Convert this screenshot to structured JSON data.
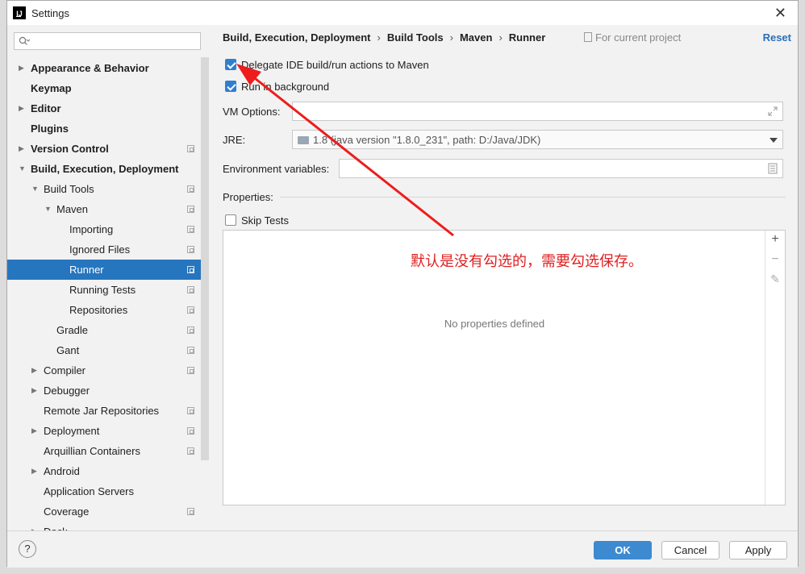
{
  "window": {
    "title": "Settings",
    "close_label": "✕"
  },
  "sidebar": {
    "search_placeholder": "",
    "items": [
      {
        "label": "Appearance & Behavior",
        "level": 0,
        "arrow": "right",
        "bold": true,
        "proj": false
      },
      {
        "label": "Keymap",
        "level": 0,
        "arrow": "",
        "bold": true,
        "proj": false
      },
      {
        "label": "Editor",
        "level": 0,
        "arrow": "right",
        "bold": true,
        "proj": false
      },
      {
        "label": "Plugins",
        "level": 0,
        "arrow": "",
        "bold": true,
        "proj": false
      },
      {
        "label": "Version Control",
        "level": 0,
        "arrow": "right",
        "bold": true,
        "proj": true
      },
      {
        "label": "Build, Execution, Deployment",
        "level": 0,
        "arrow": "down",
        "bold": true,
        "proj": false
      },
      {
        "label": "Build Tools",
        "level": 1,
        "arrow": "down",
        "bold": false,
        "proj": true
      },
      {
        "label": "Maven",
        "level": 2,
        "arrow": "down",
        "bold": false,
        "proj": true
      },
      {
        "label": "Importing",
        "level": 3,
        "arrow": "",
        "bold": false,
        "proj": true
      },
      {
        "label": "Ignored Files",
        "level": 3,
        "arrow": "",
        "bold": false,
        "proj": true
      },
      {
        "label": "Runner",
        "level": 3,
        "arrow": "",
        "bold": false,
        "proj": true,
        "selected": true
      },
      {
        "label": "Running Tests",
        "level": 3,
        "arrow": "",
        "bold": false,
        "proj": true
      },
      {
        "label": "Repositories",
        "level": 3,
        "arrow": "",
        "bold": false,
        "proj": true
      },
      {
        "label": "Gradle",
        "level": 2,
        "arrow": "",
        "bold": false,
        "proj": true
      },
      {
        "label": "Gant",
        "level": 2,
        "arrow": "",
        "bold": false,
        "proj": true
      },
      {
        "label": "Compiler",
        "level": 1,
        "arrow": "right",
        "bold": false,
        "proj": true
      },
      {
        "label": "Debugger",
        "level": 1,
        "arrow": "right",
        "bold": false,
        "proj": false
      },
      {
        "label": "Remote Jar Repositories",
        "level": 1,
        "arrow": "",
        "bold": false,
        "proj": true
      },
      {
        "label": "Deployment",
        "level": 1,
        "arrow": "right",
        "bold": false,
        "proj": true
      },
      {
        "label": "Arquillian Containers",
        "level": 1,
        "arrow": "",
        "bold": false,
        "proj": true
      },
      {
        "label": "Android",
        "level": 1,
        "arrow": "right",
        "bold": false,
        "proj": false
      },
      {
        "label": "Application Servers",
        "level": 1,
        "arrow": "",
        "bold": false,
        "proj": false
      },
      {
        "label": "Coverage",
        "level": 1,
        "arrow": "",
        "bold": false,
        "proj": true
      },
      {
        "label": "Dock",
        "level": 1,
        "arrow": "right",
        "bold": false,
        "proj": false
      }
    ]
  },
  "breadcrumb": {
    "items": [
      "Build, Execution, Deployment",
      "Build Tools",
      "Maven",
      "Runner"
    ],
    "separator": "›"
  },
  "for_current_project": "For current project",
  "reset_label": "Reset",
  "options": {
    "delegate": {
      "label": "Delegate IDE build/run actions to Maven",
      "checked": true
    },
    "background": {
      "label": "Run in background",
      "checked": true
    },
    "vm_options_label": "VM Options:",
    "vm_options_value": "",
    "jre_label": "JRE:",
    "jre_value": "1.8 (java version \"1.8.0_231\", path: D:/Java/JDK)",
    "env_label": "Environment variables:",
    "env_value": "",
    "properties_label": "Properties:",
    "skip_tests": {
      "label": "Skip Tests",
      "checked": false
    }
  },
  "properties_table": {
    "empty_text": "No properties defined",
    "add": "+",
    "remove": "−",
    "edit": "✎"
  },
  "annotation": "默认是没有勾选的，需要勾选保存。",
  "footer": {
    "help": "?",
    "ok": "OK",
    "cancel": "Cancel",
    "apply": "Apply"
  },
  "colors": {
    "accent": "#2675bf",
    "annotation": "#e02020"
  }
}
